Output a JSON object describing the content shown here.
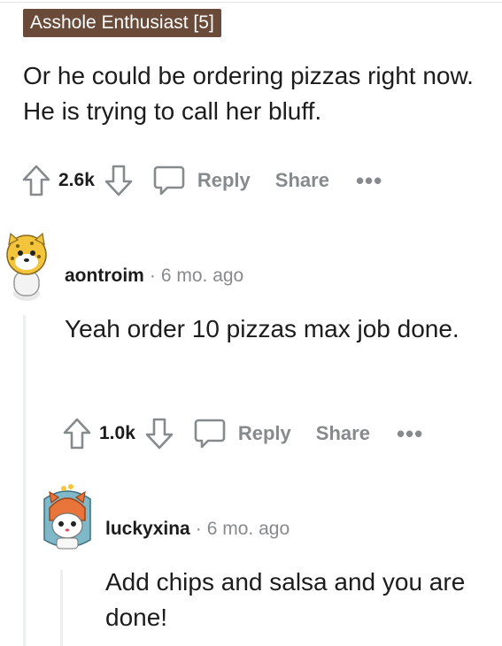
{
  "comment1": {
    "flair": "Asshole Enthusiast [5]",
    "text": "Or he could be ordering pizzas right now. He is trying to call her bluff.",
    "score": "2.6k",
    "reply_label": "Reply",
    "share_label": "Share",
    "more_label": "•••"
  },
  "comment2": {
    "username": "aontroim",
    "separator": "·",
    "time": "6 mo. ago",
    "text": "Yeah order 10 pizzas max job done.",
    "score": "1.0k",
    "reply_label": "Reply",
    "share_label": "Share",
    "more_label": "•••"
  },
  "comment3": {
    "username": "luckyxina",
    "separator": "·",
    "time": "6 mo. ago",
    "text": "Add chips and salsa and you are done!"
  },
  "icons": {
    "upvote": "upvote-arrow-icon",
    "downvote": "downvote-arrow-icon",
    "comment": "speech-bubble-icon",
    "more": "ellipsis-icon"
  },
  "colors": {
    "flair_bg": "#6a4b3a",
    "muted": "#878a8c",
    "text": "#1c1c1c",
    "thread_line": "#edeff1"
  }
}
